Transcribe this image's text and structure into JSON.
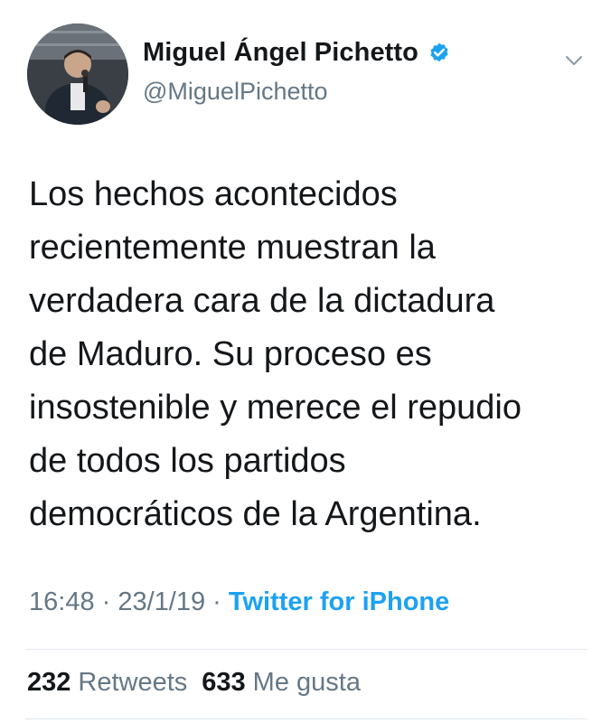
{
  "user": {
    "display_name": "Miguel Ángel Pichetto",
    "handle": "@MiguelPichetto"
  },
  "tweet": {
    "text": "Los hechos acontecidos\nrecientemente muestran la\nverdadera cara de la dictadura\nde Maduro. Su proceso es\ninsostenible y merece el repudio\nde todos los partidos\ndemocráticos de la Argentina.",
    "time": "16:48",
    "date": "23/1/19",
    "separator": " · ",
    "source": "Twitter for iPhone"
  },
  "stats": {
    "retweets_count": "232",
    "retweets_label": "Retweets",
    "likes_count": "633",
    "likes_label": "Me gusta"
  },
  "colors": {
    "text": "#14171a",
    "secondary": "#657786",
    "link": "#1da1f2",
    "verified": "#1da1f2",
    "divider": "#e1e8ed"
  },
  "icons": [
    "verified-badge-icon",
    "chevron-down-icon"
  ]
}
